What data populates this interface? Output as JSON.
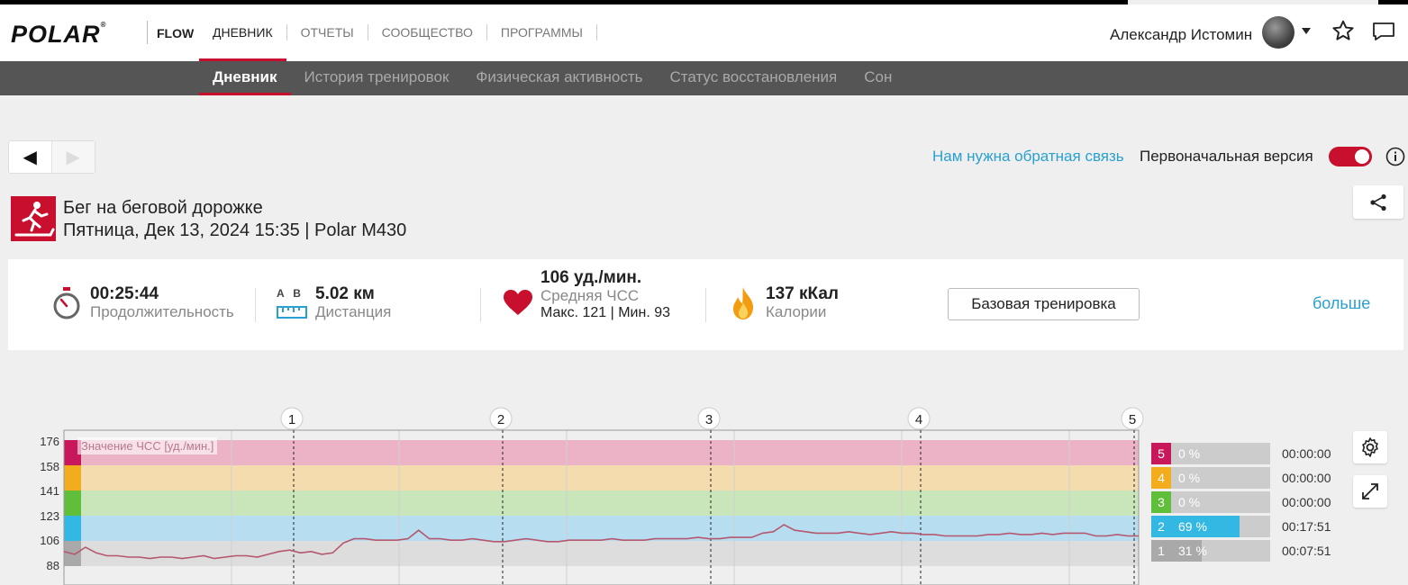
{
  "brand": {
    "logo": "POLAR",
    "logo_mark": "®",
    "product": "FLOW"
  },
  "main_nav": [
    "ДНЕВНИК",
    "ОТЧЕТЫ",
    "СООБЩЕСТВО",
    "ПРОГРАММЫ"
  ],
  "user": {
    "name": "Александр Истомин"
  },
  "sub_nav": [
    "Дневник",
    "История тренировок",
    "Физическая активность",
    "Статус восстановления",
    "Сон"
  ],
  "pager": {
    "prev": "◀",
    "next": "▶"
  },
  "feedback_link": "Нам нужна обратная связь",
  "original_version_label": "Первоначальная версия",
  "session": {
    "title": "Бег на беговой дорожке",
    "subtitle": "Пятница, Дек 13, 2024 15:35 | Polar M430"
  },
  "summary": {
    "duration_value": "00:25:44",
    "duration_label": "Продолжительность",
    "distance_ab": "A   B",
    "distance_value": "5.02 км",
    "distance_label": "Дистанция",
    "hr_value": "106 уд./мин.",
    "hr_label": "Средняя ЧСС",
    "hr_minmax": "Макс. 121  |  Мин. 93",
    "calories_value": "137 кКал",
    "calories_label": "Калории",
    "base_button": "Базовая тренировка",
    "more_link": "больше"
  },
  "chart_data": {
    "type": "line",
    "title": "Значение ЧСС [уд./мин.]",
    "yticks": [
      "176",
      "158",
      "141",
      "123",
      "106",
      "88"
    ],
    "lap_markers": [
      "1",
      "2",
      "3",
      "4",
      "5"
    ],
    "zones": [
      {
        "num": "5",
        "pct": "0 %",
        "fraction": 0,
        "time": "00:00:00",
        "color": "#c8175b",
        "band": "#ecb2c6"
      },
      {
        "num": "4",
        "pct": "0 %",
        "fraction": 0,
        "time": "00:00:00",
        "color": "#f3ac1b",
        "band": "#f4dcae"
      },
      {
        "num": "3",
        "pct": "0 %",
        "fraction": 0,
        "time": "00:00:00",
        "color": "#5fbe3a",
        "band": "#c9e6bb"
      },
      {
        "num": "2",
        "pct": "69 %",
        "fraction": 0.69,
        "time": "00:17:51",
        "color": "#33b8e4",
        "band": "#b7def0"
      },
      {
        "num": "1",
        "pct": "31 %",
        "fraction": 0.31,
        "time": "00:07:51",
        "color": "#a9a9a9",
        "band": "#dddddd"
      }
    ],
    "hr_series": [
      99,
      97,
      102,
      98,
      96,
      96,
      95,
      95,
      94,
      95,
      95,
      94,
      95,
      96,
      94,
      95,
      96,
      96,
      95,
      97,
      99,
      100,
      98,
      99,
      97,
      98,
      105,
      108,
      108,
      107,
      107,
      107,
      108,
      114,
      108,
      108,
      107,
      107,
      108,
      107,
      106,
      106,
      107,
      108,
      107,
      106,
      106,
      107,
      107,
      107,
      107,
      108,
      107,
      107,
      107,
      108,
      108,
      108,
      108,
      109,
      108,
      108,
      109,
      109,
      109,
      112,
      113,
      118,
      114,
      113,
      112,
      112,
      112,
      113,
      112,
      111,
      112,
      113,
      112,
      112,
      111,
      111,
      110,
      110,
      110,
      110,
      111,
      111,
      112,
      111,
      111,
      112,
      111,
      112,
      112,
      112,
      110,
      110,
      111,
      110,
      110
    ]
  }
}
